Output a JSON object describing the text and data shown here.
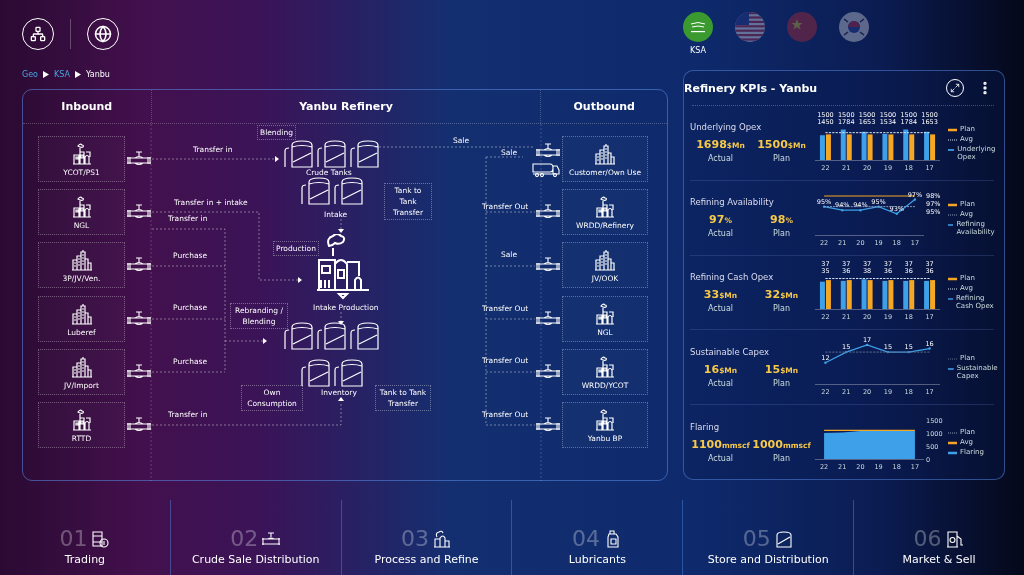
{
  "regions": [
    {
      "kind": "sa",
      "label": "KSA",
      "selected": true
    },
    {
      "kind": "us",
      "selected": false
    },
    {
      "kind": "cn",
      "selected": false
    },
    {
      "kind": "kr",
      "selected": false
    }
  ],
  "breadcrumb": [
    "Geo",
    "KSA",
    "Yanbu"
  ],
  "diagram": {
    "headings": [
      "Inbound",
      "Yanbu Refinery",
      "Outbound"
    ],
    "inbound": [
      {
        "name": "YCOT/PS1",
        "kind": "plant"
      },
      {
        "name": "NGL",
        "kind": "plant"
      },
      {
        "name": "3P/JV/Ven.",
        "kind": "city"
      },
      {
        "name": "Luberef",
        "kind": "city"
      },
      {
        "name": "JV/Import",
        "kind": "city"
      },
      {
        "name": "RTTD",
        "kind": "plant"
      }
    ],
    "outbound": [
      {
        "name": "Customer/Own Use",
        "kind": "city"
      },
      {
        "name": "WRDD/Refinery",
        "kind": "plant"
      },
      {
        "name": "JV/OOK",
        "kind": "city"
      },
      {
        "name": "NGL",
        "kind": "plant"
      },
      {
        "name": "WRDD/YCOT",
        "kind": "plant"
      },
      {
        "name": "Yanbu BP",
        "kind": "plant"
      }
    ],
    "flow_labels": [
      "Transfer in",
      "Sale",
      "Sale",
      "Transfer in + intake",
      "Transfer Out",
      "Transfer in",
      "Purchase",
      "Sale",
      "Purchase",
      "Transfer Out",
      "Purchase",
      "Transfer Out",
      "Transfer in",
      "Transfer Out"
    ],
    "notes": [
      "Blending",
      "Tank to Tank Transfer",
      "Production",
      "Rebranding / Blending",
      "Own Consumption",
      "Tank to Tank Transfer"
    ],
    "captions": [
      "Crude Tanks",
      "Intake",
      "Intake Production",
      "Inventory"
    ]
  },
  "kpi_panel": {
    "title": "Refinery KPIs - Yanbu",
    "sections": [
      {
        "title": "Underlying Opex",
        "actual": {
          "value": "1698",
          "unit": "$Mn",
          "caption": "Actual"
        },
        "plan": {
          "value": "1500",
          "unit": "$Mn",
          "caption": "Plan"
        },
        "chart_data": {
          "type": "bar",
          "categories": [
            "22",
            "21",
            "20",
            "19",
            "18",
            "17"
          ],
          "series": [
            {
              "name": "Plan",
              "color": "#f5a623",
              "values": [
                1500,
                1500,
                1500,
                1500,
                1500,
                1500
              ],
              "value_labels": [
                "1500",
                "1500",
                "1500",
                "1500",
                "1500",
                "1500"
              ]
            },
            {
              "name": "Avg",
              "type": "line",
              "line_style": "dotted",
              "color": "#d8e2f0",
              "values": [
                1600,
                1600,
                1600,
                1600,
                1600,
                1600
              ]
            },
            {
              "name": "Underlying Opex",
              "color": "#3ea0e8",
              "values": [
                1450,
                1784,
                1653,
                1534,
                1784,
                1653
              ],
              "value_labels": [
                "1450",
                "1784",
                "1653",
                "1534",
                "1784",
                "1653"
              ]
            }
          ]
        }
      },
      {
        "title": "Refining Availability",
        "actual": {
          "value": "97",
          "unit": "%",
          "caption": "Actual"
        },
        "plan": {
          "value": "98",
          "unit": "%",
          "caption": "Plan"
        },
        "chart_data": {
          "type": "line",
          "categories": [
            "22",
            "21",
            "20",
            "19",
            "18",
            "17"
          ],
          "annotations": [
            "98%",
            "97%",
            "95%"
          ],
          "series": [
            {
              "name": "Plan",
              "color": "#f5a623",
              "values": [
                98,
                98,
                98,
                98,
                98,
                98
              ]
            },
            {
              "name": "Avg",
              "line_style": "dotted",
              "color": "#8a9bb5",
              "values": [
                95,
                95,
                95,
                95,
                95,
                95
              ]
            },
            {
              "name": "Refining Availability",
              "color": "#3ea0e8",
              "values": [
                95,
                94,
                94,
                95,
                93,
                97
              ],
              "value_labels": [
                "95%",
                "94%",
                "94%",
                "95%",
                "93%",
                "97%"
              ]
            }
          ]
        }
      },
      {
        "title": "Refining Cash Opex",
        "actual": {
          "value": "33",
          "unit": "$Mn",
          "caption": "Actual"
        },
        "plan": {
          "value": "32",
          "unit": "$Mn",
          "caption": "Plan"
        },
        "chart_data": {
          "type": "bar",
          "categories": [
            "22",
            "21",
            "20",
            "19",
            "18",
            "17"
          ],
          "series": [
            {
              "name": "Plan",
              "color": "#f5a623",
              "values": [
                37,
                37,
                37,
                37,
                37,
                37
              ],
              "value_labels": [
                "37",
                "37",
                "37",
                "37",
                "37",
                "37"
              ]
            },
            {
              "name": "Avg",
              "type": "line",
              "line_style": "dotted",
              "color": "#d8e2f0",
              "values": [
                39,
                39,
                39,
                39,
                39,
                39
              ]
            },
            {
              "name": "Refining Cash Opex",
              "color": "#3ea0e8",
              "values": [
                35,
                36,
                38,
                36,
                36,
                36
              ],
              "value_labels": [
                "35",
                "36",
                "38",
                "36",
                "36",
                "36"
              ]
            }
          ]
        }
      },
      {
        "title": "Sustainable Capex",
        "actual": {
          "value": "16",
          "unit": "$Mn",
          "caption": "Actual"
        },
        "plan": {
          "value": "15",
          "unit": "$Mn",
          "caption": "Plan"
        },
        "chart_data": {
          "type": "line",
          "categories": [
            "22",
            "21",
            "20",
            "19",
            "18",
            "17"
          ],
          "series": [
            {
              "name": "Plan",
              "line_style": "dotted",
              "color": "#5a6b85",
              "values": [
                15,
                15,
                15,
                15,
                15,
                15
              ]
            },
            {
              "name": "Sustainable Capex",
              "color": "#3ea0e8",
              "values": [
                12,
                15,
                17,
                15,
                15,
                16
              ],
              "value_labels": [
                "12",
                "15",
                "17",
                "15",
                "15",
                "16"
              ]
            }
          ]
        }
      },
      {
        "title": "Flaring",
        "actual": {
          "value": "1100",
          "unit": "mmscf",
          "caption": "Actual"
        },
        "plan": {
          "value": "1000",
          "unit": "mmscf",
          "caption": "Plan"
        },
        "chart_data": {
          "type": "area",
          "categories": [
            "22",
            "21",
            "20",
            "19",
            "18",
            "17"
          ],
          "ylim": [
            0,
            1500
          ],
          "yticks": [
            0,
            500,
            1000,
            1500
          ],
          "series": [
            {
              "name": "Plan",
              "type": "line",
              "line_style": "dotted",
              "color": "#8a9bb5",
              "values": [
                null,
                null,
                null,
                null,
                null,
                null
              ]
            },
            {
              "name": "Avg",
              "type": "line",
              "color": "#f5a623",
              "values": [
                1100,
                1100,
                1100,
                1100,
                1100,
                1100
              ]
            },
            {
              "name": "Flaring",
              "color": "#3ea0e8",
              "values": [
                1000,
                1020,
                1080,
                1090,
                1100,
                1090
              ]
            }
          ]
        }
      }
    ]
  },
  "bottom_nav": [
    {
      "number": "01",
      "label": "Trading",
      "kind": "barrel"
    },
    {
      "number": "02",
      "label": "Crude Sale Distribution",
      "kind": "pipe"
    },
    {
      "number": "03",
      "label": "Process and Refine",
      "kind": "refinery"
    },
    {
      "number": "04",
      "label": "Lubricants",
      "kind": "bottle"
    },
    {
      "number": "05",
      "label": "Store and Distribution",
      "kind": "tank"
    },
    {
      "number": "06",
      "label": "Market & Sell",
      "kind": "pump"
    }
  ]
}
